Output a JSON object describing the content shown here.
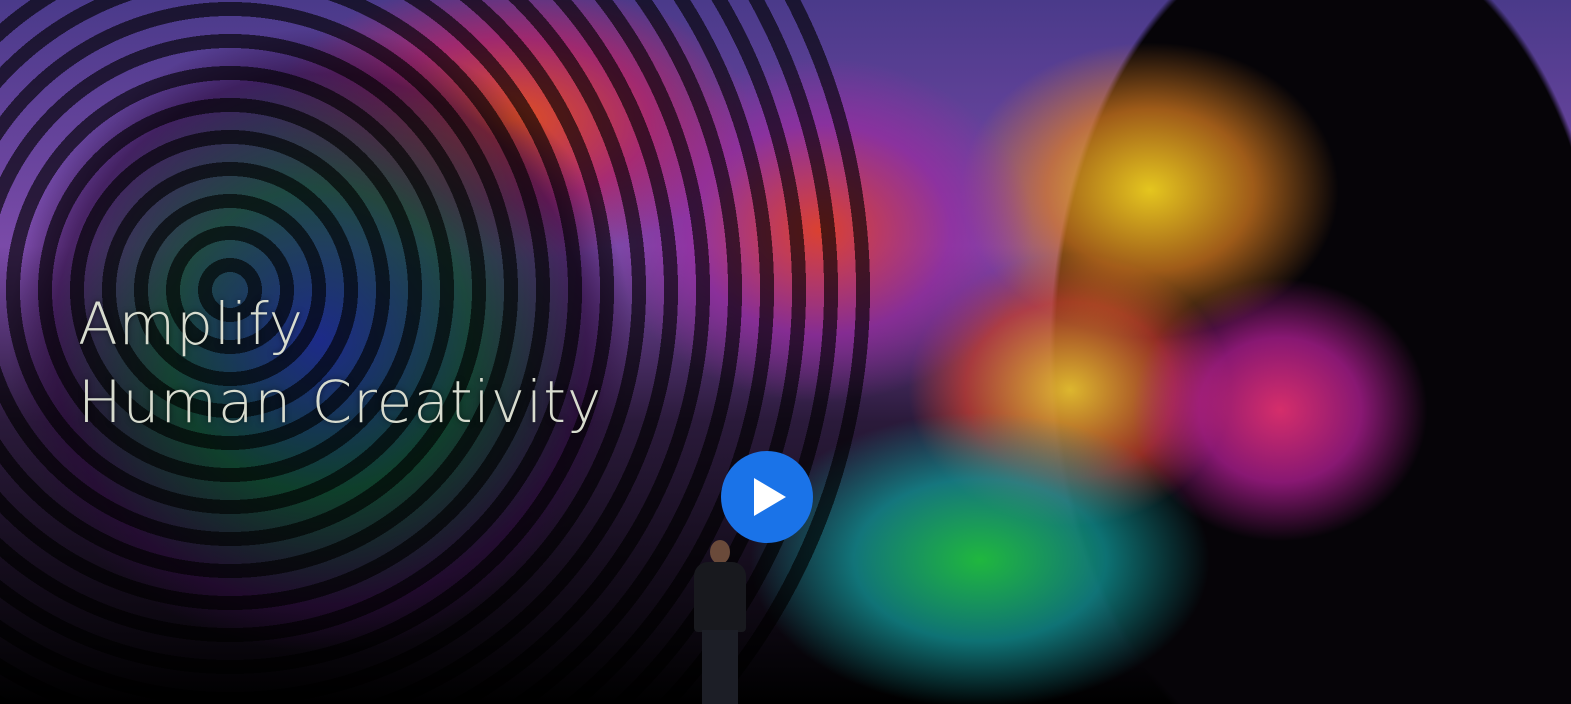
{
  "video": {
    "slide_title_line1": "Amplify",
    "slide_title_line2": "Human Creativity",
    "play_icon": "play-icon",
    "play_button_color": "#1a73e8",
    "slide_text_color": "#d8dccf"
  }
}
